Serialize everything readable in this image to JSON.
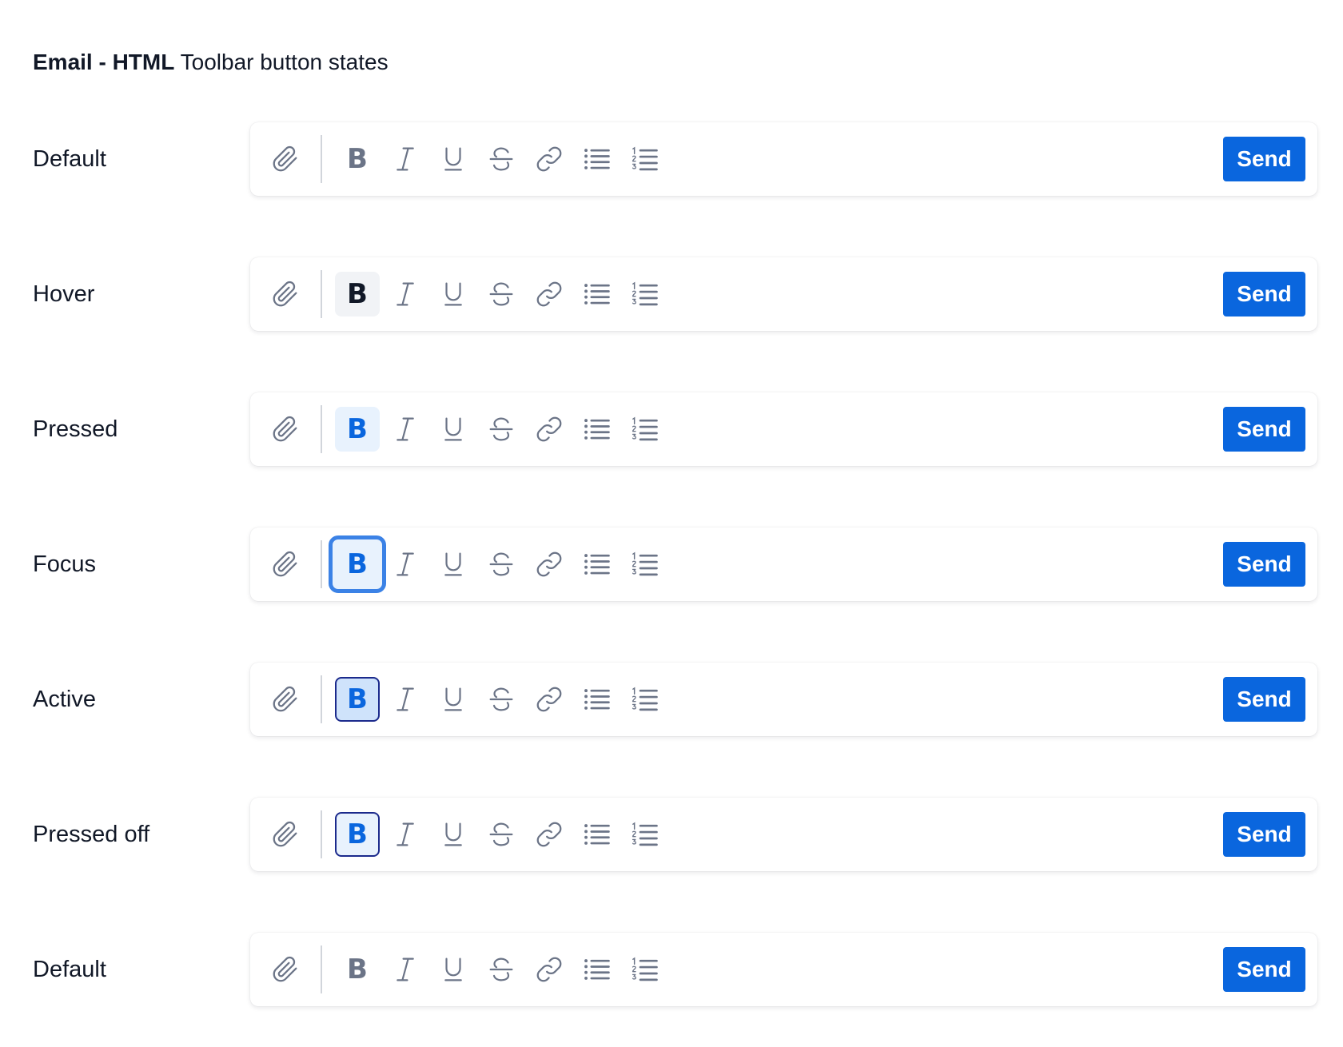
{
  "title": {
    "bold_part": "Email - HTML",
    "rest": "Toolbar button states"
  },
  "rows": [
    {
      "label": "Default",
      "state": "default"
    },
    {
      "label": "Hover",
      "state": "hover"
    },
    {
      "label": "Pressed",
      "state": "pressed"
    },
    {
      "label": "Focus",
      "state": "focus"
    },
    {
      "label": "Active",
      "state": "active"
    },
    {
      "label": "Pressed off",
      "state": "pressed-off"
    },
    {
      "label": "Default",
      "state": "default"
    }
  ],
  "toolbar": {
    "bold_glyph": "B",
    "send_label": "Send",
    "icons": [
      "paperclip-icon",
      "bold-icon",
      "italic-icon",
      "underline-icon",
      "strikethrough-icon",
      "link-icon",
      "bulleted-list-icon",
      "numbered-list-icon"
    ]
  },
  "colors": {
    "icon": "#6b7487",
    "accent": "#0a66de",
    "focus_ring": "#3b82e6",
    "active_border": "#1b2a8c",
    "pressed_bg": "#e8f2fd",
    "active_bg": "#cfe3fb",
    "hover_bg": "#f1f3f6"
  }
}
